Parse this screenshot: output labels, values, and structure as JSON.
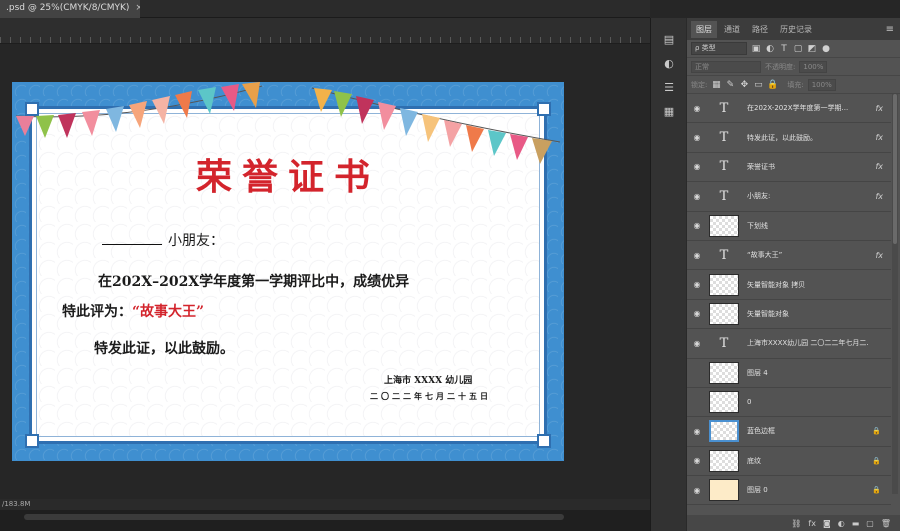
{
  "document_tab": {
    "title": ".psd @ 25%(CMYK/8/CMYK)",
    "close": "×"
  },
  "status_bar": {
    "text": "/183.8M"
  },
  "certificate": {
    "title": "荣誉证书",
    "recipient_suffix": "小朋友：",
    "body_line1": "在202X–202X学年度第一学期评比中，成绩优异",
    "body_line2_prefix": "特此评为：",
    "award_name": "“故事大王”",
    "body_line3": "特发此证，以此鼓励。",
    "issuer": "上海市 XXXX 幼儿园",
    "issue_date": "二〇二二年七月二十五日"
  },
  "panel": {
    "tabs": [
      "图层",
      "通道",
      "路径",
      "历史记录"
    ],
    "active_tab": "图层",
    "filter_label": "ρ 类型",
    "blend_mode": "正常",
    "opacity_label": "不透明度:",
    "opacity_value": "100%",
    "lock_label": "锁定:",
    "fill_label": "填充:",
    "fill_value": "100%"
  },
  "layers": [
    {
      "name": "在202X-202X学年度第一学期...",
      "kind": "text",
      "visible": true,
      "fx": true
    },
    {
      "name": "特发此证，以此鼓励。",
      "kind": "text",
      "visible": true,
      "fx": true
    },
    {
      "name": "荣誉证书",
      "kind": "text",
      "visible": true,
      "fx": true
    },
    {
      "name": "小朋友:",
      "kind": "text",
      "visible": true,
      "fx": true
    },
    {
      "name": "下划线",
      "kind": "raster",
      "visible": true,
      "fx": false
    },
    {
      "name": "“故事大王”",
      "kind": "text",
      "visible": true,
      "fx": true
    },
    {
      "name": "矢量智能对象 拷贝",
      "kind": "smart",
      "visible": true,
      "fx": false
    },
    {
      "name": "矢量智能对象",
      "kind": "smart",
      "visible": true,
      "fx": false
    },
    {
      "name": "上海市XXXX幼儿园 二〇二二年七月二...",
      "kind": "text",
      "visible": true,
      "fx": false
    },
    {
      "name": "图层 4",
      "kind": "raster",
      "visible": false,
      "fx": false
    },
    {
      "name": "0",
      "kind": "raster",
      "visible": false,
      "fx": false
    },
    {
      "name": "蓝色边框",
      "kind": "frame",
      "visible": true,
      "fx": false,
      "locked": true
    },
    {
      "name": "底纹",
      "kind": "smart",
      "visible": true,
      "fx": false,
      "locked": true
    },
    {
      "name": "图层 0",
      "kind": "cream",
      "visible": true,
      "fx": false,
      "locked": true
    }
  ],
  "colors": {
    "title_red": "#d3242c",
    "frame_blue": "#3f8fd0",
    "panel_bg": "#535353"
  }
}
